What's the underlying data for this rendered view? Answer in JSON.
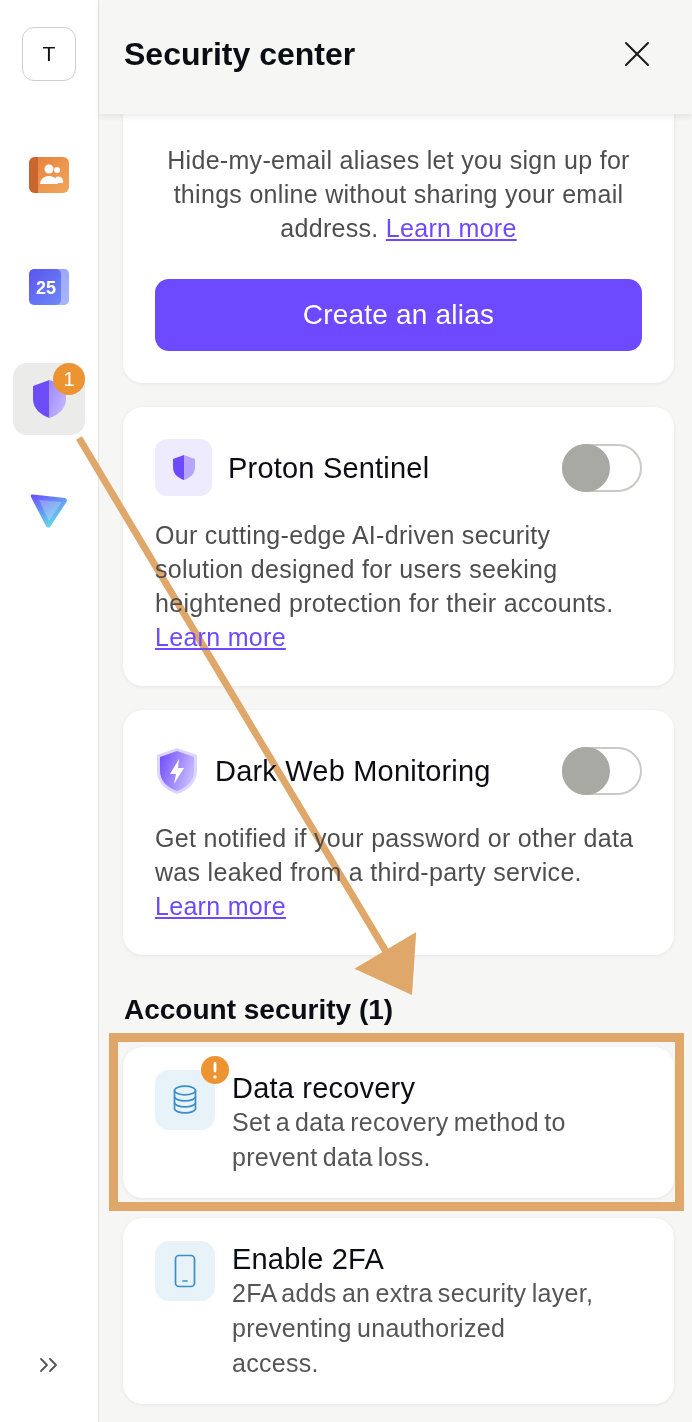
{
  "sidebar": {
    "avatar": "T",
    "items": [
      {
        "kind": "contacts",
        "selected": false
      },
      {
        "kind": "calendar",
        "label": "25",
        "selected": false
      },
      {
        "kind": "security",
        "selected": true,
        "badge": "1"
      },
      {
        "kind": "vpn",
        "selected": false
      }
    ]
  },
  "panel": {
    "title": "Security center"
  },
  "alias_card": {
    "description": "Hide-my-email aliases let you sign up for things online without sharing your email address.",
    "link": "Learn more",
    "button": "Create an alias"
  },
  "features": [
    {
      "kind": "sentinel",
      "title": "Proton Sentinel",
      "on": false,
      "description": "Our cutting-edge AI-driven security solution designed for users seeking heightened protection for their accounts.",
      "link": "Learn more"
    },
    {
      "kind": "darkweb",
      "title": "Dark Web Monitoring",
      "on": false,
      "description": "Get notified if your password or other data was leaked from a third-party service.",
      "link": "Learn more"
    }
  ],
  "account_security": {
    "heading": "Account security (1)",
    "items": [
      {
        "kind": "recovery",
        "title": "Data recovery",
        "description": "Set a data recovery method to prevent data loss.",
        "warning": true,
        "highlighted": true
      },
      {
        "kind": "twofactor",
        "title": "Enable 2FA",
        "description": "2FA adds an extra security layer, preventing unauthorized access.",
        "warning": false,
        "highlighted": false
      }
    ]
  }
}
